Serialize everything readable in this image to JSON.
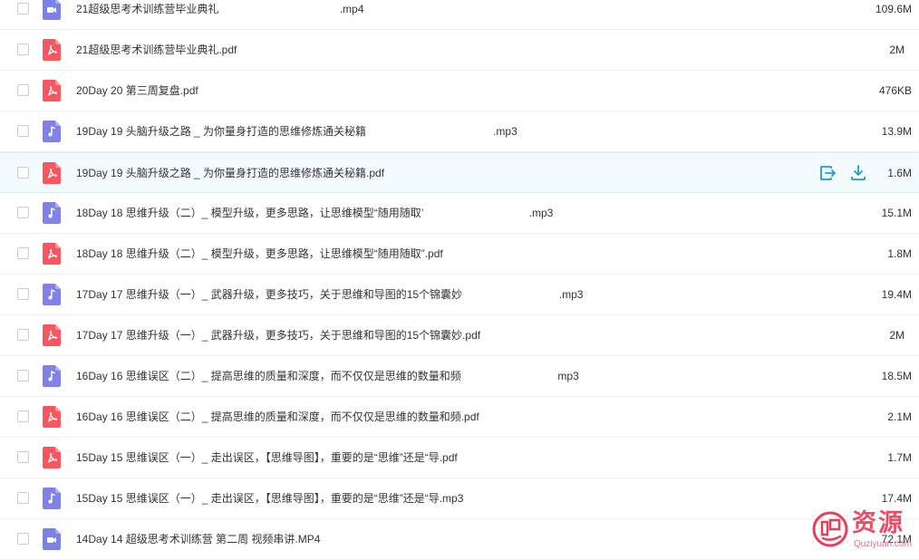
{
  "colors": {
    "pdf": "#f8575f",
    "mp3": "#8081e9",
    "mp4": "#7c81ea",
    "action": "#1e9ae0",
    "watermark": "#e8405a"
  },
  "files": [
    {
      "type": "mp4",
      "icon": "video-file-icon",
      "name": "21超级思考术训练营毕业典礼                                        .mp4",
      "size": "109.6M"
    },
    {
      "type": "pdf",
      "icon": "pdf-file-icon",
      "name": "21超级思考术训练营毕业典礼.pdf",
      "size": "2M"
    },
    {
      "type": "pdf",
      "icon": "pdf-file-icon",
      "name": "20Day 20 第三周复盘.pdf",
      "size": "476KB"
    },
    {
      "type": "mp3",
      "icon": "music-file-icon",
      "name": "19Day 19 头脑升级之路 _ 为你量身打造的思维修炼通关秘籍                                          .mp3",
      "size": "13.9M"
    },
    {
      "type": "pdf",
      "icon": "pdf-file-icon",
      "name": "19Day 19 头脑升级之路 _ 为你量身打造的思维修炼通关秘籍.pdf",
      "size": "1.6M",
      "hover": true
    },
    {
      "type": "mp3",
      "icon": "music-file-icon",
      "name": "18Day 18 思维升级（二）_ 模型升级，更多思路，让思维模型“随用随取’                                   .mp3",
      "size": "15.1M"
    },
    {
      "type": "pdf",
      "icon": "pdf-file-icon",
      "name": "18Day 18 思维升级（二）_ 模型升级，更多思路，让思维模型“随用随取”.pdf",
      "size": "1.8M"
    },
    {
      "type": "mp3",
      "icon": "music-file-icon",
      "name": "17Day 17 思维升级（一）_ 武器升级，更多技巧，关于思维和导图的15个锦囊妙                                .mp3",
      "size": "19.4M"
    },
    {
      "type": "pdf",
      "icon": "pdf-file-icon",
      "name": "17Day 17 思维升级（一）_ 武器升级，更多技巧，关于思维和导图的15个锦囊妙.pdf",
      "size": "2M"
    },
    {
      "type": "mp3",
      "icon": "music-file-icon",
      "name": "16Day 16 思维误区（二）_ 提高思维的质量和深度，而不仅仅是思维的数量和频                                mp3",
      "size": "18.5M"
    },
    {
      "type": "pdf",
      "icon": "pdf-file-icon",
      "name": "16Day 16 思维误区（二）_ 提高思维的质量和深度，而不仅仅是思维的数量和频.pdf",
      "size": "2.1M"
    },
    {
      "type": "pdf",
      "icon": "pdf-file-icon",
      "name": "15Day 15 思维误区（一）_ 走出误区，【思维导图】，重要的是“思维”还是“导.pdf",
      "size": "1.7M"
    },
    {
      "type": "mp3",
      "icon": "music-file-icon",
      "name": "15Day 15 思维误区（一）_ 走出误区，【思维导图】，重要的是“思维”还是“导.mp3",
      "size": "17.4M"
    },
    {
      "type": "mp4",
      "icon": "video-file-icon",
      "name": "14Day 14 超级思考术训练营 第二周 视频串讲.MP4",
      "size": "72.1M"
    }
  ],
  "hover_actions": {
    "share_icon": "share-icon",
    "download_icon": "download-icon"
  },
  "watermark": {
    "text": "资源",
    "url": "Quziyuan.com",
    "logo_icon": "qu-logo-icon"
  }
}
